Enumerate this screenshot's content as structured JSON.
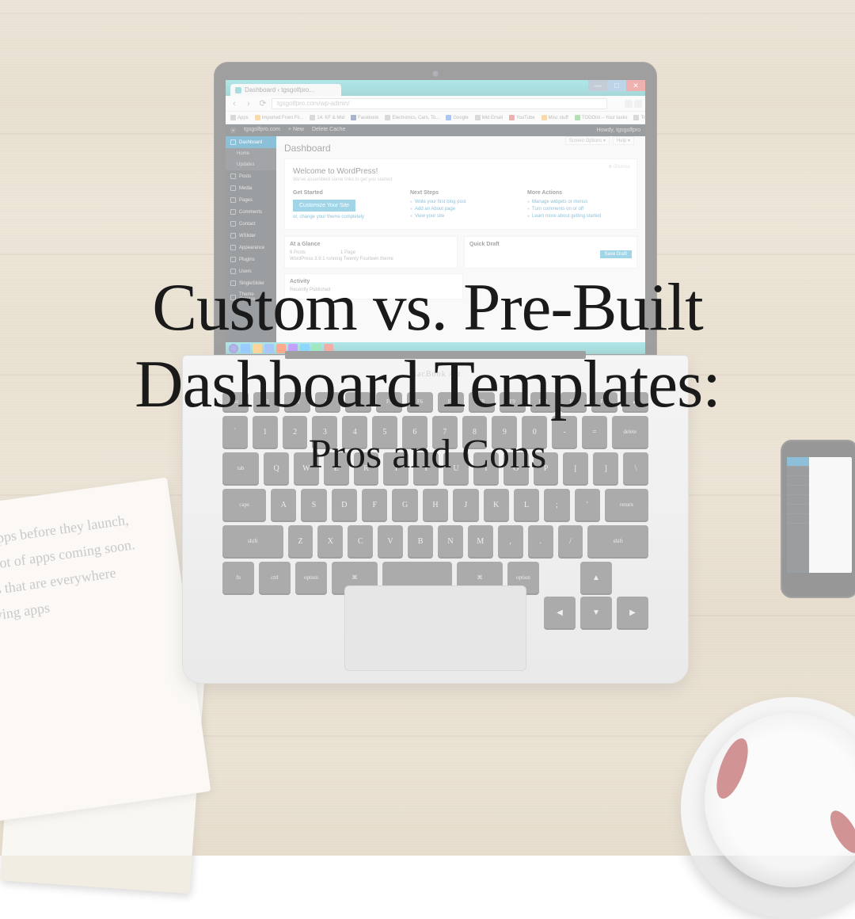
{
  "overlay": {
    "title_line1": "Custom vs. Pre-Built",
    "title_line2": "Dashboard Templates:",
    "subtitle": "Pros and Cons"
  },
  "browser": {
    "tab_title": "Dashboard ‹ tgsgolfpro...",
    "url": "tgsgolfpro.com/wp-admin/",
    "bookmarks_label": "Apps",
    "bookmarks": [
      "Imported From Fir...",
      "14. KF & Mid",
      "Facebook",
      "Electronics, Cars, To...",
      "Google",
      "Mid Email",
      "YouTube",
      "Misc stuff",
      "TODOist – Your tasks",
      "Track my order | wa..."
    ]
  },
  "wp_topbar": {
    "site": "tgsgolfpro.com",
    "new": "+ New",
    "cache": "Delete Cache",
    "howdy": "Howdy, tgsgolfpro"
  },
  "wp_sidebar": {
    "items": [
      {
        "label": "Dashboard",
        "active": true
      },
      {
        "label": "Home",
        "sub": true
      },
      {
        "label": "Updates",
        "sub": true
      },
      {
        "label": "Posts"
      },
      {
        "label": "Media"
      },
      {
        "label": "Pages"
      },
      {
        "label": "Comments"
      },
      {
        "label": "Contact"
      },
      {
        "label": "WSlider"
      },
      {
        "label": "Appearance"
      },
      {
        "label": "Plugins"
      },
      {
        "label": "Users"
      },
      {
        "label": "SingleSlider"
      },
      {
        "label": "Theme Options"
      }
    ]
  },
  "wp_main": {
    "heading": "Dashboard",
    "screen_options": "Screen Options ▾",
    "help": "Help ▾",
    "welcome": {
      "title": "Welcome to WordPress!",
      "subtitle": "We've assembled some links to get you started:",
      "dismiss": "⊗ Dismiss",
      "col1_title": "Get Started",
      "cta": "Customize Your Site",
      "theme_change": "or, change your theme completely",
      "col2_title": "Next Steps",
      "col2_links": [
        "Write your first blog post",
        "Add an About page",
        "View your site"
      ],
      "col3_title": "More Actions",
      "col3_links": [
        "Manage widgets or menus",
        "Turn comments on or off",
        "Learn more about getting started"
      ]
    },
    "glance": {
      "title": "At a Glance",
      "posts": "6 Posts",
      "pages": "1 Page",
      "comments": "",
      "running": "WordPress 3.9.1 running Twenty Fourteen theme"
    },
    "quick_draft": {
      "title": "Quick Draft",
      "save": "Save Draft"
    },
    "activity": {
      "title": "Activity",
      "recent": "Recently Published"
    }
  },
  "keyboard": {
    "fn_row": [
      "esc",
      "F1",
      "F2",
      "F3",
      "F4",
      "F5",
      "F6",
      "F7",
      "F8",
      "F9",
      "F10",
      "F11",
      "F12",
      "⏏"
    ],
    "row1": [
      "`",
      "1",
      "2",
      "3",
      "4",
      "5",
      "6",
      "7",
      "8",
      "9",
      "0",
      "-",
      "=",
      "delete"
    ],
    "row2": [
      "tab",
      "Q",
      "W",
      "E",
      "R",
      "T",
      "Y",
      "U",
      "I",
      "O",
      "P",
      "[",
      "]",
      "\\"
    ],
    "row3": [
      "caps",
      "A",
      "S",
      "D",
      "F",
      "G",
      "H",
      "J",
      "K",
      "L",
      ";",
      "'",
      "return"
    ],
    "row4": [
      "shift",
      "Z",
      "X",
      "C",
      "V",
      "B",
      "N",
      "M",
      ",",
      ".",
      "/",
      "shift"
    ],
    "row5": [
      "fn",
      "ctrl",
      "option",
      "⌘",
      "",
      "⌘",
      "option",
      "◀",
      "▲▼",
      "▶"
    ]
  },
  "logo": "MacBook Air",
  "colors": {
    "wp_accent": "#0073aa",
    "wp_cta": "#2ea2cc",
    "text_dark": "#1a1a1a"
  }
}
